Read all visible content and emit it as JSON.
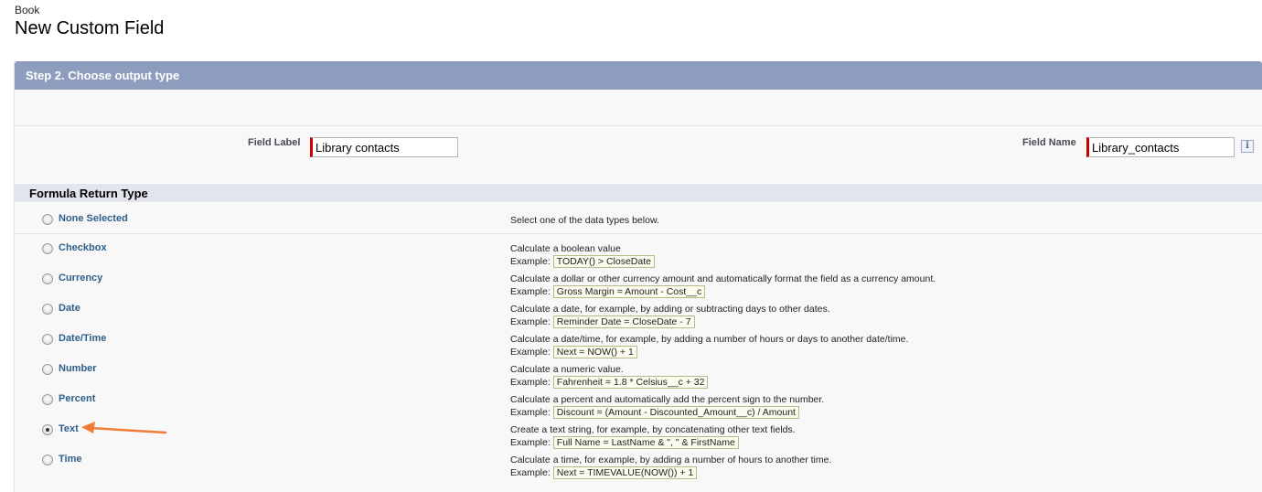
{
  "header": {
    "object_name": "Book",
    "title": "New Custom Field"
  },
  "step": {
    "label": "Step 2. Choose output type"
  },
  "fields": {
    "field_label": {
      "label": "Field Label",
      "value": "Library contacts"
    },
    "field_name": {
      "label": "Field Name",
      "value": "Library_contacts"
    },
    "info_icon_glyph": "i"
  },
  "formula": {
    "heading": "Formula Return Type",
    "none": {
      "label": "None Selected",
      "description": "Select one of the data types below."
    },
    "example_label": "Example:",
    "options": [
      {
        "label": "Checkbox",
        "description": "Calculate a boolean value",
        "example": "TODAY() > CloseDate",
        "selected": false
      },
      {
        "label": "Currency",
        "description": "Calculate a dollar or other currency amount and automatically format the field as a currency amount.",
        "example": "Gross Margin = Amount - Cost__c",
        "selected": false
      },
      {
        "label": "Date",
        "description": "Calculate a date, for example, by adding or subtracting days to other dates.",
        "example": "Reminder Date = CloseDate - 7",
        "selected": false
      },
      {
        "label": "Date/Time",
        "description": "Calculate a date/time, for example, by adding a number of hours or days to another date/time.",
        "example": "Next = NOW() + 1",
        "selected": false
      },
      {
        "label": "Number",
        "description": "Calculate a numeric value.",
        "example": "Fahrenheit = 1.8 * Celsius__c + 32",
        "selected": false
      },
      {
        "label": "Percent",
        "description": "Calculate a percent and automatically add the percent sign to the number.",
        "example": "Discount = (Amount - Discounted_Amount__c) / Amount",
        "selected": false
      },
      {
        "label": "Text",
        "description": "Create a text string, for example, by concatenating other text fields.",
        "example": "Full Name = LastName & \", \" & FirstName",
        "selected": true
      },
      {
        "label": "Time",
        "description": "Calculate a time, for example, by adding a number of hours to another time.",
        "example": "Next = TIMEVALUE(NOW()) + 1",
        "selected": false
      }
    ]
  },
  "colors": {
    "arrow": "#f07c3a",
    "step_bar": "#8e9dbe",
    "option_label": "#2e5f8a"
  }
}
